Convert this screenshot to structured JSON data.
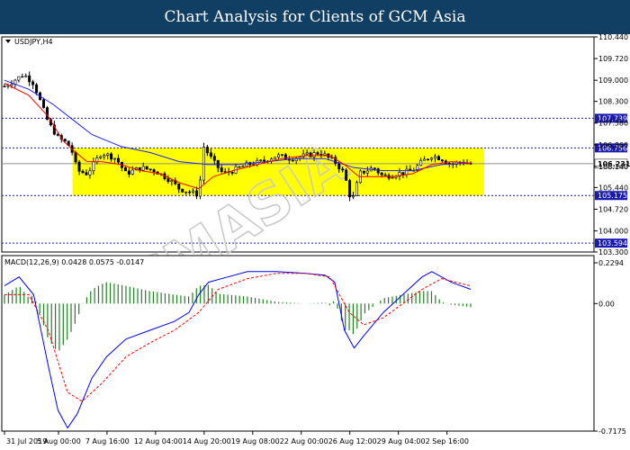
{
  "header": {
    "title": "Chart Analysis for Clients of GCM Asia"
  },
  "watermark": {
    "text": "GCMASIA",
    "subtext": "GLOBAL CAPITAL MARKETS"
  },
  "colors": {
    "banner": "#103f63",
    "zone": "#ffff00",
    "level_line": "#1a1ab0",
    "current_line": "#909090",
    "ma_fast": "#ff0000",
    "ma_slow": "#2020ff",
    "bull_candle": "#ffffff",
    "bear_candle": "#000000",
    "histogram": "#208020",
    "macd_line": "#0000ff",
    "signal_line": "#ff0000"
  },
  "chart_data": [
    {
      "type": "candlestick",
      "title": "USDJPY,H4",
      "y_ticks": [
        "110.440",
        "109.720",
        "109.000",
        "108.300",
        "107.580",
        "106.860",
        "106.140",
        "105.440",
        "104.720",
        "104.000",
        "103.300"
      ],
      "ylim": [
        103.3,
        110.44
      ],
      "x_ticks": [
        "31 Jul 2019",
        "5 Aug 00:00",
        "7 Aug 16:00",
        "12 Aug 04:00",
        "14 Aug 20:00",
        "19 Aug 08:00",
        "22 Aug 00:00",
        "26 Aug 12:00",
        "29 Aug 04:00",
        "2 Sep 16:00"
      ],
      "levels": [
        {
          "value": 107.739,
          "label": "107.739"
        },
        {
          "value": 106.756,
          "label": "106.756"
        },
        {
          "value": 105.175,
          "label": "105.175"
        },
        {
          "value": 103.594,
          "label": "103.594"
        }
      ],
      "current_price": {
        "value": 106.231,
        "label": "106.231"
      },
      "zone": {
        "from": 105.175,
        "to": 106.756
      },
      "price_path": [
        [
          0,
          108.8
        ],
        [
          4,
          109.2
        ],
        [
          6,
          108.9
        ],
        [
          9,
          107.6
        ],
        [
          11,
          107.1
        ],
        [
          13,
          106.9
        ],
        [
          14,
          106.6
        ],
        [
          15,
          106.0
        ],
        [
          17,
          105.9
        ],
        [
          20,
          106.6
        ],
        [
          23,
          106.4
        ],
        [
          25,
          105.9
        ],
        [
          28,
          106.1
        ],
        [
          31,
          106.0
        ],
        [
          34,
          105.7
        ],
        [
          36,
          105.4
        ],
        [
          38,
          105.3
        ],
        [
          40,
          105.2
        ],
        [
          41,
          106.8
        ],
        [
          43,
          106.3
        ],
        [
          45,
          105.9
        ],
        [
          47,
          106.0
        ],
        [
          50,
          106.2
        ],
        [
          53,
          106.3
        ],
        [
          56,
          106.5
        ],
        [
          59,
          106.4
        ],
        [
          62,
          106.5
        ],
        [
          65,
          106.6
        ],
        [
          68,
          106.3
        ],
        [
          70,
          105.9
        ],
        [
          71,
          105.2
        ],
        [
          72,
          105.1
        ],
        [
          73,
          105.9
        ],
        [
          76,
          106.1
        ],
        [
          78,
          105.8
        ],
        [
          81,
          105.9
        ],
        [
          84,
          106.0
        ],
        [
          86,
          106.3
        ],
        [
          88,
          106.5
        ],
        [
          90,
          106.4
        ],
        [
          92,
          106.2
        ],
        [
          94,
          106.3
        ],
        [
          96,
          106.23
        ]
      ],
      "ma_fast_path": [
        [
          0,
          108.9
        ],
        [
          5,
          108.5
        ],
        [
          9,
          107.8
        ],
        [
          12,
          107.0
        ],
        [
          14,
          106.7
        ],
        [
          17,
          106.3
        ],
        [
          20,
          106.3
        ],
        [
          24,
          106.2
        ],
        [
          28,
          106.0
        ],
        [
          32,
          105.9
        ],
        [
          36,
          105.6
        ],
        [
          40,
          105.4
        ],
        [
          43,
          105.8
        ],
        [
          47,
          106.0
        ],
        [
          52,
          106.2
        ],
        [
          57,
          106.4
        ],
        [
          62,
          106.5
        ],
        [
          67,
          106.5
        ],
        [
          70,
          106.2
        ],
        [
          73,
          105.8
        ],
        [
          76,
          105.8
        ],
        [
          80,
          105.8
        ],
        [
          84,
          105.9
        ],
        [
          88,
          106.2
        ],
        [
          92,
          106.3
        ],
        [
          96,
          106.25
        ]
      ],
      "ma_slow_path": [
        [
          0,
          109.0
        ],
        [
          5,
          108.7
        ],
        [
          10,
          108.2
        ],
        [
          14,
          107.7
        ],
        [
          18,
          107.2
        ],
        [
          24,
          106.8
        ],
        [
          30,
          106.6
        ],
        [
          36,
          106.3
        ],
        [
          42,
          106.2
        ],
        [
          48,
          106.2
        ],
        [
          54,
          106.3
        ],
        [
          60,
          106.4
        ],
        [
          66,
          106.4
        ],
        [
          72,
          106.1
        ],
        [
          78,
          106.0
        ],
        [
          84,
          106.0
        ],
        [
          90,
          106.2
        ],
        [
          96,
          106.25
        ]
      ],
      "x_span": [
        0,
        96
      ]
    },
    {
      "type": "macd",
      "label": "MACD(12,26,9) 0.0428 0.0575 -0.0147",
      "y_ticks": [
        "0.2294",
        "0.00",
        "-0.7175"
      ],
      "ylim": [
        -0.7175,
        0.2294
      ],
      "macd_path": [
        [
          0,
          0.1
        ],
        [
          3,
          0.15
        ],
        [
          6,
          0.05
        ],
        [
          9,
          -0.35
        ],
        [
          11,
          -0.6
        ],
        [
          13,
          -0.7
        ],
        [
          15,
          -0.62
        ],
        [
          18,
          -0.42
        ],
        [
          21,
          -0.3
        ],
        [
          25,
          -0.2
        ],
        [
          30,
          -0.15
        ],
        [
          35,
          -0.1
        ],
        [
          38,
          -0.05
        ],
        [
          40,
          0.05
        ],
        [
          42,
          0.12
        ],
        [
          46,
          0.15
        ],
        [
          50,
          0.18
        ],
        [
          56,
          0.18
        ],
        [
          62,
          0.17
        ],
        [
          66,
          0.16
        ],
        [
          68,
          0.12
        ],
        [
          70,
          -0.15
        ],
        [
          72,
          -0.25
        ],
        [
          74,
          -0.18
        ],
        [
          78,
          -0.05
        ],
        [
          82,
          0.05
        ],
        [
          86,
          0.15
        ],
        [
          88,
          0.18
        ],
        [
          92,
          0.12
        ],
        [
          96,
          0.08
        ]
      ],
      "signal_path": [
        [
          0,
          0.05
        ],
        [
          5,
          0.05
        ],
        [
          9,
          -0.15
        ],
        [
          13,
          -0.5
        ],
        [
          16,
          -0.55
        ],
        [
          20,
          -0.45
        ],
        [
          25,
          -0.3
        ],
        [
          30,
          -0.22
        ],
        [
          35,
          -0.15
        ],
        [
          40,
          -0.05
        ],
        [
          44,
          0.08
        ],
        [
          50,
          0.14
        ],
        [
          56,
          0.17
        ],
        [
          62,
          0.17
        ],
        [
          67,
          0.15
        ],
        [
          71,
          -0.05
        ],
        [
          74,
          -0.12
        ],
        [
          78,
          -0.08
        ],
        [
          82,
          0.0
        ],
        [
          86,
          0.08
        ],
        [
          90,
          0.14
        ],
        [
          96,
          0.1
        ]
      ],
      "x_span": [
        0,
        96
      ]
    }
  ]
}
